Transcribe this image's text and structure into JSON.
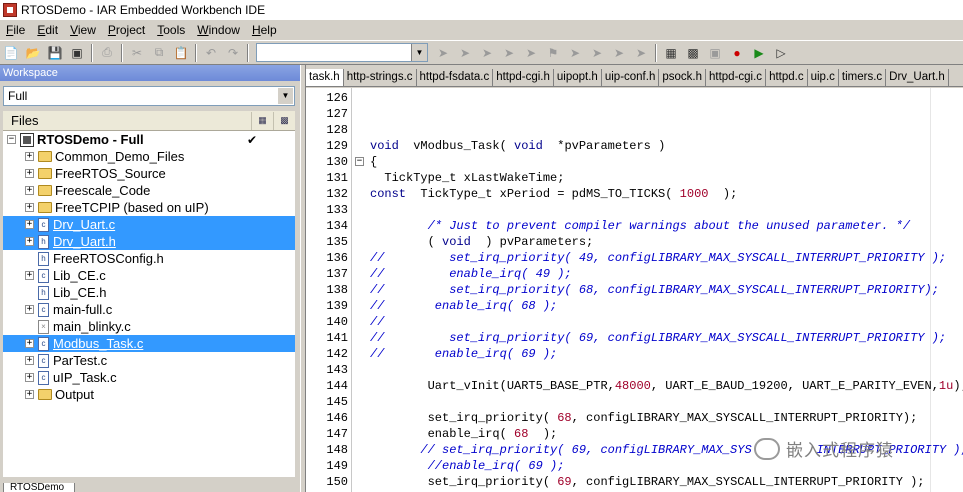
{
  "window": {
    "title": "RTOSDemo - IAR Embedded Workbench IDE"
  },
  "menu": [
    {
      "label": "File",
      "u": "F",
      "rest": "ile"
    },
    {
      "label": "Edit",
      "u": "E",
      "rest": "dit"
    },
    {
      "label": "View",
      "u": "V",
      "rest": "iew"
    },
    {
      "label": "Project",
      "u": "P",
      "rest": "roject"
    },
    {
      "label": "Tools",
      "u": "T",
      "rest": "ools"
    },
    {
      "label": "Window",
      "u": "W",
      "rest": "indow"
    },
    {
      "label": "Help",
      "u": "H",
      "rest": "elp"
    }
  ],
  "toolbar": {
    "combo_value": "",
    "icons": [
      "new-file-icon",
      "open-folder-icon",
      "save-icon",
      "save-all-icon",
      "print-icon",
      "cut-icon",
      "copy-icon",
      "paste-icon",
      "undo-icon",
      "redo-icon"
    ]
  },
  "workspace": {
    "header": "Workspace",
    "config": "Full",
    "files_label": "Files",
    "tree": [
      {
        "label": "RTOSDemo - Full",
        "kind": "project",
        "indent": 0,
        "expander": "−",
        "checked": true,
        "selected": false
      },
      {
        "label": "Common_Demo_Files",
        "kind": "folder",
        "indent": 1,
        "expander": "+",
        "selected": false
      },
      {
        "label": "FreeRTOS_Source",
        "kind": "folder",
        "indent": 1,
        "expander": "+",
        "selected": false
      },
      {
        "label": "Freescale_Code",
        "kind": "folder",
        "indent": 1,
        "expander": "+",
        "selected": false
      },
      {
        "label": "FreeTCPIP (based on uIP)",
        "kind": "folder",
        "indent": 1,
        "expander": "+",
        "selected": false
      },
      {
        "label": "Drv_Uart.c",
        "kind": "file",
        "indent": 1,
        "expander": "+",
        "selected": true
      },
      {
        "label": "Drv_Uart.h",
        "kind": "file",
        "indent": 1,
        "expander": "+",
        "selected": true
      },
      {
        "label": "FreeRTOSConfig.h",
        "kind": "file",
        "indent": 1,
        "expander": "",
        "selected": false
      },
      {
        "label": "Lib_CE.c",
        "kind": "file",
        "indent": 1,
        "expander": "+",
        "selected": false
      },
      {
        "label": "Lib_CE.h",
        "kind": "file",
        "indent": 1,
        "expander": "",
        "selected": false
      },
      {
        "label": "main-full.c",
        "kind": "file",
        "indent": 1,
        "expander": "+",
        "selected": false
      },
      {
        "label": "main_blinky.c",
        "kind": "file-excluded",
        "indent": 1,
        "expander": "",
        "selected": false
      },
      {
        "label": "Modbus_Task.c",
        "kind": "file",
        "indent": 1,
        "expander": "+",
        "selected": true
      },
      {
        "label": "ParTest.c",
        "kind": "file",
        "indent": 1,
        "expander": "+",
        "selected": false
      },
      {
        "label": "uIP_Task.c",
        "kind": "file",
        "indent": 1,
        "expander": "+",
        "selected": false
      },
      {
        "label": "Output",
        "kind": "folder",
        "indent": 1,
        "expander": "+",
        "selected": false
      }
    ],
    "bottom_tab": "RTOSDemo"
  },
  "editor": {
    "tabs": [
      "task.h",
      "http-strings.c",
      "httpd-fsdata.c",
      "httpd-cgi.h",
      "uipopt.h",
      "uip-conf.h",
      "psock.h",
      "httpd-cgi.c",
      "httpd.c",
      "uip.c",
      "timers.c",
      "Drv_Uart.h"
    ],
    "lines": [
      {
        "n": "126",
        "fold": "",
        "parts": []
      },
      {
        "n": "127",
        "fold": "",
        "parts": []
      },
      {
        "n": "128",
        "fold": "",
        "parts": []
      },
      {
        "n": "129",
        "fold": "",
        "parts": [
          [
            "kw",
            "void"
          ],
          [
            "",
            "  vModbus_Task( "
          ],
          [
            "kw",
            "void"
          ],
          [
            "",
            "  *pvParameters )"
          ]
        ]
      },
      {
        "n": "130",
        "fold": "−",
        "parts": [
          [
            "",
            "{"
          ]
        ]
      },
      {
        "n": "131",
        "fold": "",
        "parts": [
          [
            "",
            "  TickType_t xLastWakeTime;"
          ]
        ]
      },
      {
        "n": "132",
        "fold": "",
        "parts": [
          [
            "kw",
            "const"
          ],
          [
            "",
            "  TickType_t xPeriod = pdMS_TO_TICKS( "
          ],
          [
            "num",
            "1000"
          ],
          [
            "",
            "  );"
          ]
        ]
      },
      {
        "n": "133",
        "fold": "",
        "parts": []
      },
      {
        "n": "134",
        "fold": "",
        "parts": [
          [
            "",
            "        "
          ],
          [
            "cm",
            "/* Just to prevent compiler warnings about the unused parameter. */"
          ]
        ]
      },
      {
        "n": "135",
        "fold": "",
        "parts": [
          [
            "",
            "        ( "
          ],
          [
            "kw",
            "void"
          ],
          [
            "",
            "  ) pvParameters;"
          ]
        ]
      },
      {
        "n": "136",
        "fold": "",
        "parts": [
          [
            "cm",
            "//         set_irq_priority( 49, configLIBRARY_MAX_SYSCALL_INTERRUPT_PRIORITY );"
          ]
        ]
      },
      {
        "n": "137",
        "fold": "",
        "parts": [
          [
            "cm",
            "//         enable_irq( 49 );"
          ]
        ]
      },
      {
        "n": "138",
        "fold": "",
        "parts": [
          [
            "cm",
            "//         set_irq_priority( 68, configLIBRARY_MAX_SYSCALL_INTERRUPT_PRIORITY);"
          ]
        ]
      },
      {
        "n": "139",
        "fold": "",
        "parts": [
          [
            "cm",
            "//       enable_irq( 68 );"
          ]
        ]
      },
      {
        "n": "140",
        "fold": "",
        "parts": [
          [
            "cm",
            "//"
          ]
        ]
      },
      {
        "n": "141",
        "fold": "",
        "parts": [
          [
            "cm",
            "//         set_irq_priority( 69, configLIBRARY_MAX_SYSCALL_INTERRUPT_PRIORITY );"
          ]
        ]
      },
      {
        "n": "142",
        "fold": "",
        "parts": [
          [
            "cm",
            "//       enable_irq( 69 );"
          ]
        ]
      },
      {
        "n": "143",
        "fold": "",
        "parts": []
      },
      {
        "n": "144",
        "fold": "",
        "parts": [
          [
            "",
            "        Uart_vInit(UART5_BASE_PTR,"
          ],
          [
            "num",
            "48000"
          ],
          [
            "",
            ", UART_E_BAUD_19200, UART_E_PARITY_EVEN,"
          ],
          [
            "num",
            "1u"
          ],
          [
            "",
            ");"
          ]
        ]
      },
      {
        "n": "145",
        "fold": "",
        "parts": []
      },
      {
        "n": "146",
        "fold": "",
        "parts": [
          [
            "",
            "        set_irq_priority( "
          ],
          [
            "num",
            "68"
          ],
          [
            "",
            ", configLIBRARY_MAX_SYSCALL_INTERRUPT_PRIORITY);"
          ]
        ]
      },
      {
        "n": "147",
        "fold": "",
        "parts": [
          [
            "",
            "        enable_irq( "
          ],
          [
            "num",
            "68"
          ],
          [
            "",
            "  );"
          ]
        ]
      },
      {
        "n": "148",
        "fold": "",
        "parts": [
          [
            "cm",
            "       // set_irq_priority( 69, configLIBRARY_MAX_SYS         INTERRUPT_PRIORITY );"
          ]
        ]
      },
      {
        "n": "149",
        "fold": "",
        "parts": [
          [
            "cm",
            "        //enable_irq( 69 );"
          ]
        ]
      },
      {
        "n": "150",
        "fold": "",
        "parts": [
          [
            "",
            "        set_irq_priority( "
          ],
          [
            "num",
            "69"
          ],
          [
            "",
            ", configLIBRARY_MAX_SYSCALL_INTERRUPT_PRIORITY );"
          ]
        ]
      }
    ]
  },
  "watermark": "嵌入式程序猿"
}
